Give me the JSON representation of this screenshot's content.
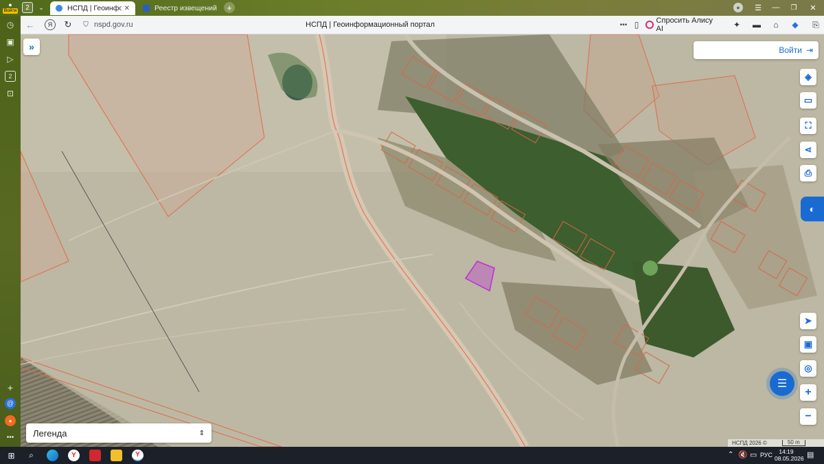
{
  "browser": {
    "profile_label": "Войти",
    "tab_counter": "2",
    "tabs": [
      {
        "title": "НСПД | Геоинформаци",
        "active": true
      },
      {
        "title": "Реестр извещений",
        "active": false
      }
    ],
    "url": "nspd.gov.ru",
    "page_title": "НСПД | Геоинформационный портал",
    "alice_label": "Спросить Алису AI",
    "sidebar_counter": "2"
  },
  "map": {
    "login_label": "Войти",
    "legend_label": "Легенда",
    "attribution": "НСПД 2026 ©",
    "scale_label": "50 m",
    "highlight_color": "#c02ad8",
    "parcel_color": "#e0694e"
  },
  "taskbar": {
    "lang": "РУС",
    "time": "14:19",
    "date": "08.05.2026"
  }
}
